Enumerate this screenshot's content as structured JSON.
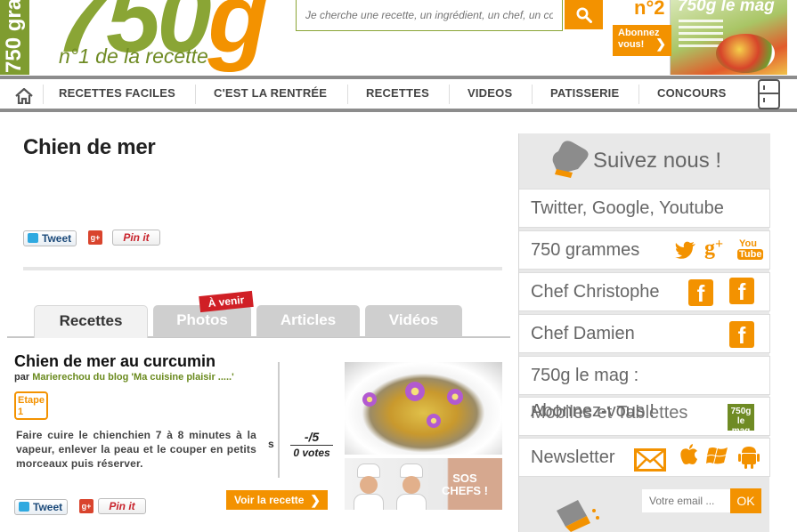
{
  "header": {
    "side_strip_text": "750 gra",
    "logo_number": "750",
    "logo_letter": "g",
    "tagline": "n°1 de la recette",
    "search": {
      "placeholder": "Je cherche une recette, un ingrédient, un chef, un co"
    },
    "subscribe": {
      "line1": "Abonnez",
      "line2": "vous!"
    },
    "magazine": {
      "issue": "n°2",
      "title": "750g le mag"
    }
  },
  "nav": {
    "items": [
      "RECETTES FACILES",
      "C'EST LA RENTRÉE",
      "RECETTES",
      "VIDEOS",
      "PATISSERIE",
      "CONCOURS"
    ]
  },
  "page": {
    "title": "Chien de mer",
    "share": {
      "tweet": "Tweet",
      "gplus": "g+",
      "pin": "Pin it"
    }
  },
  "tabs": {
    "items": [
      "Recettes",
      "Photos",
      "Articles",
      "Vidéos"
    ],
    "active": "Recettes",
    "upcoming_badge": "À venir"
  },
  "recipe": {
    "title": "Chien de mer au curcumin",
    "by_prefix": "par",
    "by_link": "Marierechou du blog 'Ma cuisine plaisir .....'",
    "step_label_1": "Etape",
    "step_label_2": "1",
    "text": "Faire cuire le chienchien 7 à 8 minutes à la vapeur, enlever la peau et le couper en petits morceaux puis réserver.",
    "cut_letter": "s",
    "rating": {
      "score": "-/5",
      "votes": "0 votes"
    },
    "sos_banner": {
      "line1": "SOS",
      "line2": "CHEFS !"
    },
    "cta": "Voir la recette",
    "share": {
      "tweet": "Tweet",
      "gplus": "g+",
      "pin": "Pin it"
    }
  },
  "sidebar": {
    "heading": "Suivez nous !",
    "rows": [
      {
        "label": "Twitter, Google, Youtube"
      },
      {
        "label": "750 grammes"
      },
      {
        "label": "Chef Christophe"
      },
      {
        "label": "Chef Damien"
      },
      {
        "label": "750g le mag :"
      },
      {
        "label_a": "Abonnez-vous !",
        "label_b": "Mobiles et Tablettes",
        "badge": "750g le mag"
      },
      {
        "label": "Newsletter"
      }
    ],
    "email": {
      "placeholder": "Votre email ..."
    },
    "ok": "OK"
  },
  "colors": {
    "accent_orange": "#f39200",
    "brand_green": "#8aa535",
    "nav_border": "#8c8c8c"
  }
}
